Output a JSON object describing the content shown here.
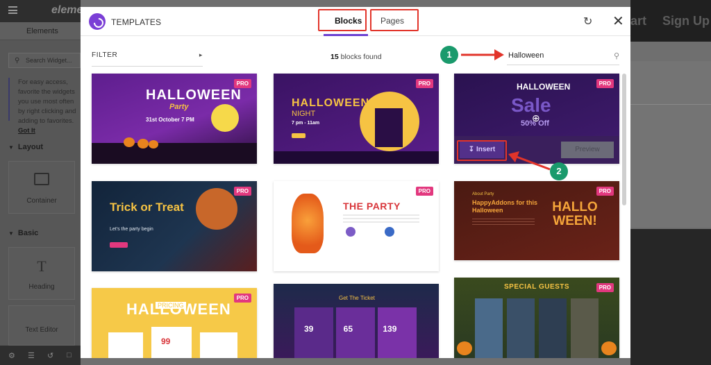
{
  "editor": {
    "logo_text": "eleme",
    "tab_elements": "Elements",
    "search_placeholder": "Search Widget...",
    "tip_text": "For easy access, favorite the widgets you use most often by right clicking and adding to favorites.",
    "tip_link": "Got It",
    "section_layout": "Layout",
    "widget_container": "Container",
    "section_basic": "Basic",
    "widget_heading": "Heading",
    "widget_text_editor": "Text Editor",
    "canvas_start": "art",
    "canvas_signup": "Sign Up"
  },
  "modal": {
    "title": "TEMPLATES",
    "tabs": [
      {
        "label": "Blocks",
        "active": true
      },
      {
        "label": "Pages",
        "active": false
      }
    ],
    "filter_label": "FILTER",
    "count_number": "15",
    "count_text": "blocks found",
    "search_value": "Halloween",
    "pro_badge": "PRO",
    "insert_label": "Insert",
    "preview_label": "Preview"
  },
  "cards": [
    {
      "title": "HALLOWEEN",
      "subtitle": "Party",
      "footer": "31st October  7 PM"
    },
    {
      "title": "HALLOWEEN",
      "subtitle": "NIGHT",
      "footer": "7 pm - 11am"
    },
    {
      "title": "HALLOWEEN",
      "subtitle": "Sale",
      "footer": "50% Off"
    },
    {
      "title": "Trick or Treat",
      "subtitle": "Let's the party begin",
      "footer": ""
    },
    {
      "title": "THE PARTY",
      "subtitle": "",
      "footer": ""
    },
    {
      "title": "HappyAddons for this Halloween",
      "subtitle": "About Party",
      "footer": "HALLO WEEN!"
    },
    {
      "title": "HALLOWEEN",
      "subtitle": "PRICING",
      "footer": "99"
    },
    {
      "title": "Get The Ticket",
      "subtitle": "",
      "footer": "39  65  139"
    },
    {
      "title": "SPECIAL GUESTS",
      "subtitle": "",
      "footer": ""
    }
  ],
  "annotations": [
    {
      "number": "1",
      "target": "search-input"
    },
    {
      "number": "2",
      "target": "insert-button"
    }
  ],
  "colors": {
    "accent": "#6a3fd1",
    "pro_badge": "#e2387e",
    "annotation_green": "#1a9a6c",
    "highlight_red": "#e2342a"
  }
}
